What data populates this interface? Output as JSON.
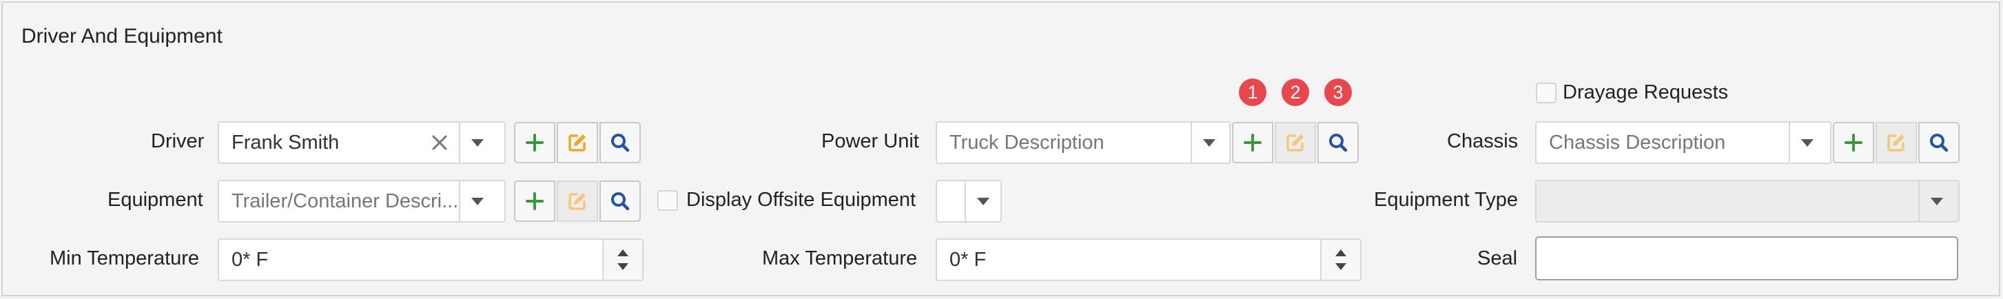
{
  "section": {
    "title": "Driver And Equipment"
  },
  "driver": {
    "label": "Driver",
    "value": "Frank Smith"
  },
  "equipment": {
    "label": "Equipment",
    "placeholder": "Trailer/Container Descri..."
  },
  "min_temperature": {
    "label": "Min Temperature",
    "value": "0* F"
  },
  "power_unit": {
    "label": "Power Unit",
    "placeholder": "Truck Description"
  },
  "display_offsite": {
    "label": "Display Offsite Equipment",
    "checked": false
  },
  "max_temperature": {
    "label": "Max Temperature",
    "value": "0* F"
  },
  "drayage_requests": {
    "label": "Drayage Requests",
    "checked": false
  },
  "chassis": {
    "label": "Chassis",
    "placeholder": "Chassis Description"
  },
  "equipment_type": {
    "label": "Equipment Type",
    "value": ""
  },
  "seal": {
    "label": "Seal",
    "value": ""
  },
  "badges": [
    "1",
    "2",
    "3"
  ],
  "icons": {
    "clear": "close-icon",
    "dropdown": "chevron-down-icon",
    "add": "plus-icon",
    "edit": "edit-icon",
    "search": "search-icon"
  },
  "colors": {
    "add_icon": "#3a9a3a",
    "edit_icon": "#f2a623",
    "edit_icon_disabled": "#f5c77a",
    "search_icon": "#2352a5",
    "badge": "#e8474e"
  }
}
